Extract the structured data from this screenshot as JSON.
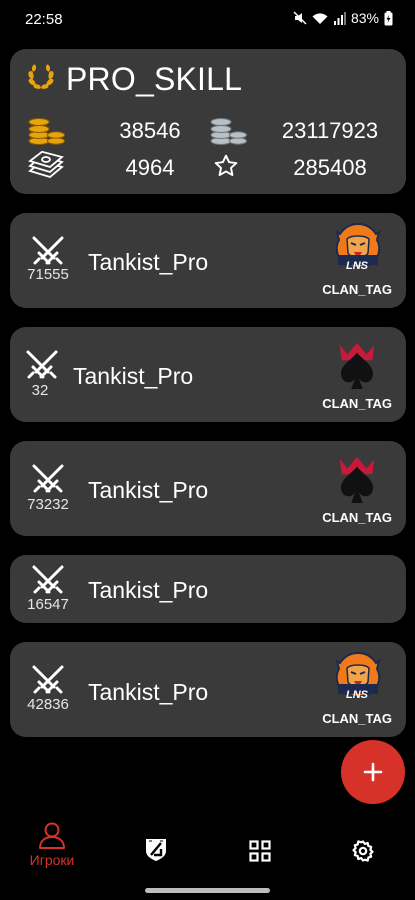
{
  "status": {
    "time": "22:58",
    "battery": "83%"
  },
  "profile": {
    "name": "PRO_SKILL",
    "gold": "38546",
    "silver": "23117923",
    "cash": "4964",
    "rating": "285408"
  },
  "players": [
    {
      "kills": "71555",
      "name": "Tankist_Pro",
      "clan_tag": "CLAN_TAG",
      "logo": "lion-logo"
    },
    {
      "kills": "32",
      "name": "Tankist_Pro",
      "clan_tag": "CLAN_TAG",
      "logo": "spade-crown-logo"
    },
    {
      "kills": "73232",
      "name": "Tankist_Pro",
      "clan_tag": "CLAN_TAG",
      "logo": "spade-crown-logo"
    },
    {
      "kills": "16547",
      "name": "Tankist_Pro",
      "clan_tag": "",
      "logo": ""
    },
    {
      "kills": "42836",
      "name": "Tankist_Pro",
      "clan_tag": "CLAN_TAG",
      "logo": "lion-logo"
    }
  ],
  "logo_text": "LNS",
  "nav": {
    "players_label": "Игроки"
  },
  "colors": {
    "accent": "#d6322a",
    "card": "#3a3a3a",
    "gold": "#e8a40d",
    "silver": "#b8c0c6"
  }
}
